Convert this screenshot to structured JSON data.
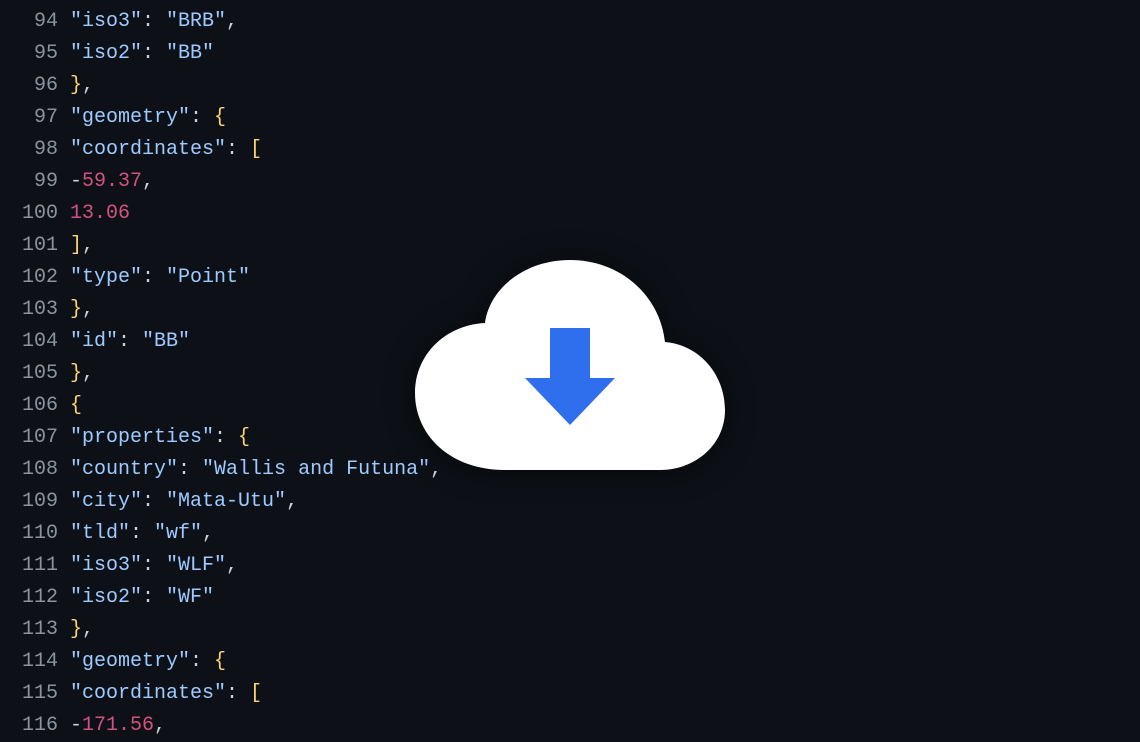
{
  "overlay_icon": "cloud-download",
  "lines": [
    {
      "num": 94,
      "tokens": [
        {
          "t": "key",
          "v": "\"iso3\""
        },
        {
          "t": "colon",
          "v": ": "
        },
        {
          "t": "str",
          "v": "\"BRB\""
        },
        {
          "t": "punc",
          "v": ","
        }
      ]
    },
    {
      "num": 95,
      "tokens": [
        {
          "t": "key",
          "v": "\"iso2\""
        },
        {
          "t": "colon",
          "v": ": "
        },
        {
          "t": "str",
          "v": "\"BB\""
        }
      ]
    },
    {
      "num": 96,
      "tokens": [
        {
          "t": "brace",
          "v": "}"
        },
        {
          "t": "punc",
          "v": ","
        }
      ]
    },
    {
      "num": 97,
      "tokens": [
        {
          "t": "key",
          "v": "\"geometry\""
        },
        {
          "t": "colon",
          "v": ": "
        },
        {
          "t": "brace",
          "v": "{"
        }
      ]
    },
    {
      "num": 98,
      "tokens": [
        {
          "t": "key",
          "v": "\"coordinates\""
        },
        {
          "t": "colon",
          "v": ": "
        },
        {
          "t": "brack",
          "v": "["
        }
      ]
    },
    {
      "num": 99,
      "tokens": [
        {
          "t": "punc",
          "v": "-"
        },
        {
          "t": "num",
          "v": "59.37"
        },
        {
          "t": "punc",
          "v": ","
        }
      ]
    },
    {
      "num": 100,
      "tokens": [
        {
          "t": "num",
          "v": "13.06"
        }
      ]
    },
    {
      "num": 101,
      "tokens": [
        {
          "t": "brack",
          "v": "]"
        },
        {
          "t": "punc",
          "v": ","
        }
      ]
    },
    {
      "num": 102,
      "tokens": [
        {
          "t": "key",
          "v": "\"type\""
        },
        {
          "t": "colon",
          "v": ": "
        },
        {
          "t": "str",
          "v": "\"Point\""
        }
      ]
    },
    {
      "num": 103,
      "tokens": [
        {
          "t": "brace",
          "v": "}"
        },
        {
          "t": "punc",
          "v": ","
        }
      ]
    },
    {
      "num": 104,
      "tokens": [
        {
          "t": "key",
          "v": "\"id\""
        },
        {
          "t": "colon",
          "v": ": "
        },
        {
          "t": "str",
          "v": "\"BB\""
        }
      ]
    },
    {
      "num": 105,
      "tokens": [
        {
          "t": "brace",
          "v": "}"
        },
        {
          "t": "punc",
          "v": ","
        }
      ]
    },
    {
      "num": 106,
      "tokens": [
        {
          "t": "brace",
          "v": "{"
        }
      ]
    },
    {
      "num": 107,
      "tokens": [
        {
          "t": "key",
          "v": "\"properties\""
        },
        {
          "t": "colon",
          "v": ": "
        },
        {
          "t": "brace",
          "v": "{"
        }
      ]
    },
    {
      "num": 108,
      "tokens": [
        {
          "t": "key",
          "v": "\"country\""
        },
        {
          "t": "colon",
          "v": ": "
        },
        {
          "t": "str",
          "v": "\"Wallis and Futuna\""
        },
        {
          "t": "punc",
          "v": ","
        }
      ]
    },
    {
      "num": 109,
      "tokens": [
        {
          "t": "key",
          "v": "\"city\""
        },
        {
          "t": "colon",
          "v": ": "
        },
        {
          "t": "str",
          "v": "\"Mata-Utu\""
        },
        {
          "t": "punc",
          "v": ","
        }
      ]
    },
    {
      "num": 110,
      "tokens": [
        {
          "t": "key",
          "v": "\"tld\""
        },
        {
          "t": "colon",
          "v": ": "
        },
        {
          "t": "str",
          "v": "\"wf\""
        },
        {
          "t": "punc",
          "v": ","
        }
      ]
    },
    {
      "num": 111,
      "tokens": [
        {
          "t": "key",
          "v": "\"iso3\""
        },
        {
          "t": "colon",
          "v": ": "
        },
        {
          "t": "str",
          "v": "\"WLF\""
        },
        {
          "t": "punc",
          "v": ","
        }
      ]
    },
    {
      "num": 112,
      "tokens": [
        {
          "t": "key",
          "v": "\"iso2\""
        },
        {
          "t": "colon",
          "v": ": "
        },
        {
          "t": "str",
          "v": "\"WF\""
        }
      ]
    },
    {
      "num": 113,
      "tokens": [
        {
          "t": "brace",
          "v": "}"
        },
        {
          "t": "punc",
          "v": ","
        }
      ]
    },
    {
      "num": 114,
      "tokens": [
        {
          "t": "key",
          "v": "\"geometry\""
        },
        {
          "t": "colon",
          "v": ": "
        },
        {
          "t": "brace",
          "v": "{"
        }
      ]
    },
    {
      "num": 115,
      "tokens": [
        {
          "t": "key",
          "v": "\"coordinates\""
        },
        {
          "t": "colon",
          "v": ": "
        },
        {
          "t": "brack",
          "v": "["
        }
      ]
    },
    {
      "num": 116,
      "tokens": [
        {
          "t": "punc",
          "v": "-"
        },
        {
          "t": "num",
          "v": "171.56"
        },
        {
          "t": "punc",
          "v": ","
        }
      ]
    }
  ]
}
